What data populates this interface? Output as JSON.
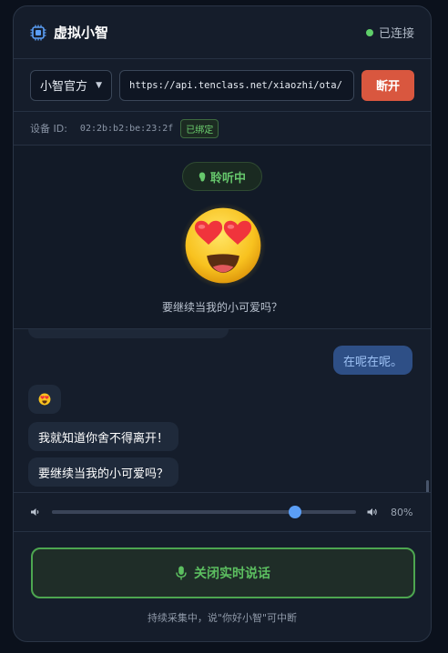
{
  "header": {
    "title": "虚拟小智",
    "status_text": "已连接",
    "status_color": "#5fcf6a"
  },
  "server": {
    "selected_source": "小智官方",
    "url": "https://api.tenclass.net/xiaozhi/ota/",
    "disconnect_label": "断开"
  },
  "device": {
    "label": "设备 ID:",
    "id": "02:2b:b2:be:23:2f",
    "badge": "已绑定"
  },
  "avatar": {
    "listening_label": "聆听中",
    "emotion_icon": "heart-eyes-emoji",
    "caption": "要继续当我的小可爱吗？"
  },
  "chat": {
    "user_message": "在呢在呢。",
    "bot_messages": [
      "😍",
      "我就知道你舍不得离开！",
      "要继续当我的小可爱吗？"
    ]
  },
  "volume": {
    "value_text": "80%",
    "level": 0.8
  },
  "talk": {
    "button_label": "关闭实时说话",
    "hint": "持续采集中，说\"你好小智\"可中断"
  },
  "colors": {
    "accent": "#5b9ef5",
    "danger": "#d9573f",
    "success": "#4da650"
  }
}
